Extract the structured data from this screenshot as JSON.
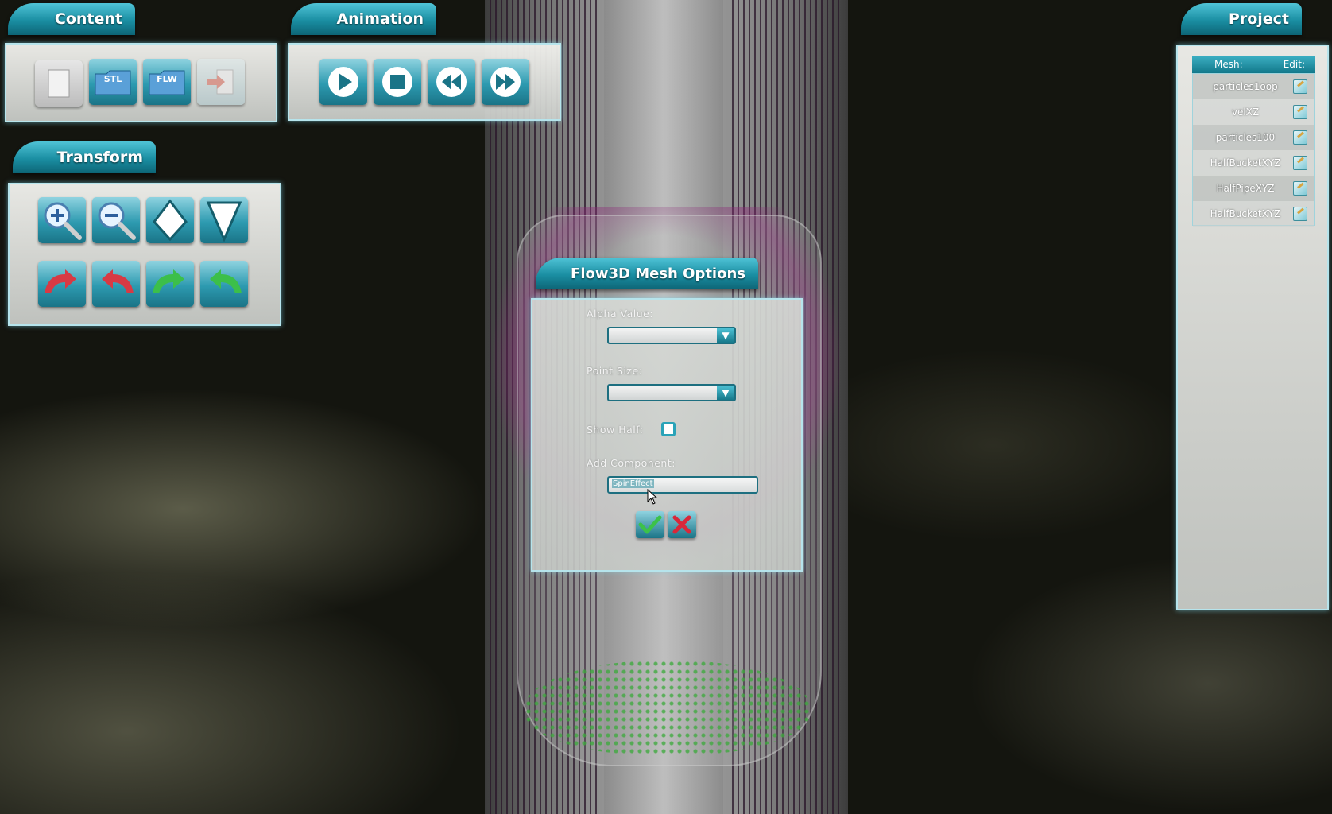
{
  "panels": {
    "content": {
      "title": "Content",
      "buttons": {
        "stl_label": "STL",
        "flw_label": "FLW"
      }
    },
    "animation": {
      "title": "Animation"
    },
    "transform": {
      "title": "Transform"
    },
    "project": {
      "title": "Project",
      "columns": {
        "mesh": "Mesh:",
        "edit": "Edit:"
      },
      "items": [
        {
          "name": "particles1oop"
        },
        {
          "name": "velXZ"
        },
        {
          "name": "particles100"
        },
        {
          "name": "HalfBucketXYZ"
        },
        {
          "name": "HalfPipeXYZ"
        },
        {
          "name": "HalfBucketXYZ"
        }
      ]
    }
  },
  "dialog": {
    "title": "Flow3D Mesh Options",
    "alpha_label": "Alpha Value:",
    "point_size_label": "Point Size:",
    "show_half_label": "Show Half:",
    "show_half_checked": false,
    "add_component_label": "Add Component:",
    "add_component_value": "SpinEffect"
  },
  "colors": {
    "accent": "#1a8ea2",
    "panel_bg": "#e8e8e4",
    "confirm": "#3cc24a",
    "cancel": "#d8283a"
  },
  "icons": {
    "content": [
      "new-file-icon",
      "open-stl-folder-icon",
      "open-flw-folder-icon",
      "export-icon"
    ],
    "animation": [
      "play-icon",
      "stop-icon",
      "rewind-icon",
      "fast-forward-icon"
    ],
    "transform": [
      "zoom-in-icon",
      "zoom-out-icon",
      "move-up-icon",
      "move-down-icon",
      "rotate-left-red-icon",
      "rotate-right-red-icon",
      "rotate-left-green-icon",
      "rotate-right-green-icon"
    ]
  }
}
